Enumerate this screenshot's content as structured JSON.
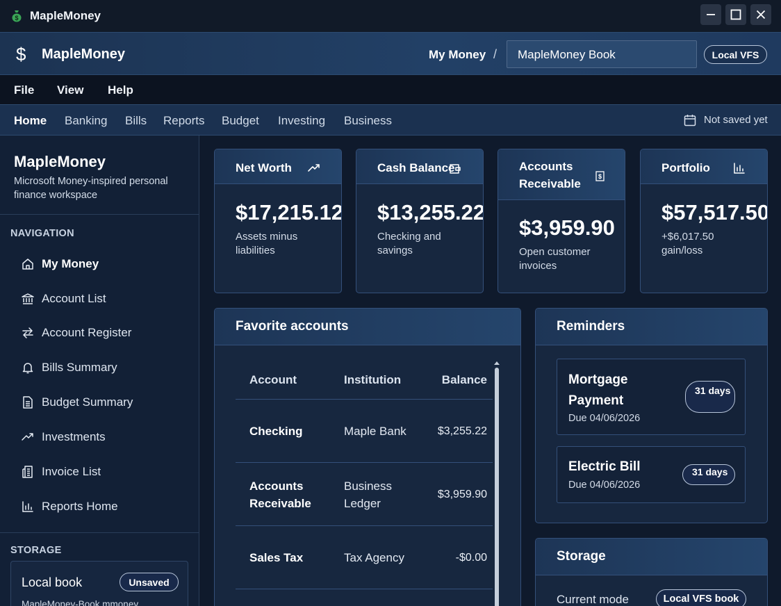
{
  "window": {
    "title": "MapleMoney"
  },
  "header": {
    "brand": "MapleMoney",
    "breadcrumb": "My Money",
    "separator": "/",
    "book_name": "MapleMoney Book",
    "storage_badge": "Local VFS"
  },
  "menu": [
    "File",
    "View",
    "Help"
  ],
  "tabs": [
    {
      "label": "Home",
      "active": true
    },
    {
      "label": "Banking"
    },
    {
      "label": "Bills"
    },
    {
      "label": "Reports"
    },
    {
      "label": "Budget"
    },
    {
      "label": "Investing"
    },
    {
      "label": "Business"
    }
  ],
  "save_status": "Not saved yet",
  "sidebar": {
    "title": "MapleMoney",
    "subtitle": "Microsoft Money-inspired personal finance workspace",
    "nav_label": "NAVIGATION",
    "items": [
      {
        "label": "My Money",
        "icon": "home-icon",
        "active": true
      },
      {
        "label": "Account List",
        "icon": "bank-icon"
      },
      {
        "label": "Account Register",
        "icon": "transfer-arrows-icon"
      },
      {
        "label": "Bills Summary",
        "icon": "bell-icon"
      },
      {
        "label": "Budget Summary",
        "icon": "budget-sheet-icon"
      },
      {
        "label": "Investments",
        "icon": "trend-up-icon"
      },
      {
        "label": "Invoice List",
        "icon": "invoice-icon"
      },
      {
        "label": "Reports Home",
        "icon": "bar-chart-icon"
      }
    ],
    "storage_label": "STORAGE",
    "storage_card": {
      "title": "Local book",
      "badge": "Unsaved",
      "file": "MapleMoney-Book.mmoney"
    }
  },
  "stats": [
    {
      "title": "Net Worth",
      "icon": "trend-up-icon",
      "value": "$17,215.12",
      "desc": "Assets minus liabilities"
    },
    {
      "title": "Cash Balance",
      "icon": "wallet-icon",
      "value": "$13,255.22",
      "desc": "Checking and savings"
    },
    {
      "title": "Accounts Receivable",
      "icon": "invoice-dollar-icon",
      "value": "$3,959.90",
      "desc": "Open customer invoices"
    },
    {
      "title": "Portfolio",
      "icon": "bar-chart-icon",
      "value": "$57,517.50",
      "desc": "+$6,017.50 gain/loss"
    }
  ],
  "favorites": {
    "title": "Favorite accounts",
    "columns": [
      "Account",
      "Institution",
      "Balance"
    ],
    "rows": [
      {
        "account": "Checking",
        "institution": "Maple Bank",
        "balance": "$3,255.22"
      },
      {
        "account": "Accounts Receivable",
        "institution": "Business Ledger",
        "balance": "$3,959.90"
      },
      {
        "account": "Sales Tax",
        "institution": "Tax Agency",
        "balance": "-$0.00"
      }
    ]
  },
  "reminders": {
    "title": "Reminders",
    "items": [
      {
        "title": "Mortgage Payment",
        "due": "Due 04/06/2026",
        "badge": "31 days"
      },
      {
        "title": "Electric Bill",
        "due": "Due 04/06/2026",
        "badge": "31 days"
      }
    ]
  },
  "storage_panel": {
    "title": "Storage",
    "mode_label": "Current mode",
    "mode_badge": "Local VFS book"
  },
  "colors": {
    "background": "#0f1a2c",
    "header_blue": "#224066",
    "card": "#17273f",
    "border": "#34507a",
    "app_icon_green": "#3aa657"
  }
}
